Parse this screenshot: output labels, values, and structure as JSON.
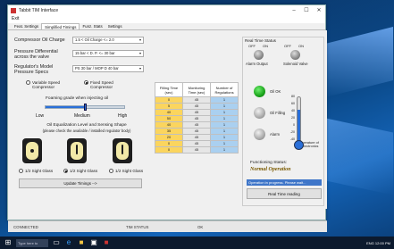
{
  "window": {
    "title": "Tabbit TIM Interface",
    "controls": [
      "–",
      "☐",
      "✕"
    ],
    "menu": "Exit"
  },
  "tabs": [
    {
      "label": "Feat. Settings",
      "active": false
    },
    {
      "label": "Simplified Timings",
      "active": true
    },
    {
      "label": "Funz. Stats",
      "active": false
    },
    {
      "label": "Settings",
      "active": false
    }
  ],
  "form": {
    "compressor_oil_label": "Compressor Oil Charge",
    "compressor_oil_value": "1.5 < Oil Charge <= 2.0",
    "pressure_label_1": "Pressure Differential",
    "pressure_label_2": "across the valve",
    "pressure_value": "15 bar < D. P. <= 30 bar",
    "regulator_label_1": "Regulator's Model",
    "regulator_label_2": "Pressure Specs",
    "regulator_value": "PS 30 bar / MOP D 40 bar",
    "variable_speed_1": "Variable Speed",
    "variable_speed_2": "Compressor",
    "fixed_speed_1": "Fixed Speed",
    "fixed_speed_2": "Compressor",
    "fixed_speed_selected": true,
    "foaming_label": "Foaming grade when injecting oil",
    "foaming_levels": [
      "Low",
      "Medium",
      "High"
    ],
    "foaming_level_fraction": 0.5,
    "equalization_label_1": "Oil Equalization Level and Sensing Shape",
    "equalization_label_2": "(please check the available / installed regulator body)",
    "sight_options": [
      "1/2 Sight Glass",
      "1/2 Sight Glass",
      "1/2 Sight Glass"
    ],
    "sight_selected_index": 1,
    "update_button": "Update Timings -->"
  },
  "table": {
    "headers": [
      "Filling Time (sec)",
      "Monitoring Time (sec)",
      "Number of Regulations"
    ],
    "rows": [
      [
        "0",
        "45",
        "1"
      ],
      [
        "5",
        "45",
        "1"
      ],
      [
        "40",
        "45",
        "1"
      ],
      [
        "50",
        "45",
        "1"
      ],
      [
        "40",
        "45",
        "1"
      ],
      [
        "35",
        "45",
        "1"
      ],
      [
        "20",
        "45",
        "1"
      ],
      [
        "0",
        "45",
        "1"
      ],
      [
        "0",
        "45",
        "1"
      ]
    ]
  },
  "realtime": {
    "title": "Real Time Status",
    "switch1_states": [
      "OFF",
      "ON"
    ],
    "switch2_states": [
      "OFF",
      "ON"
    ],
    "switch1_label": "Alarm Output",
    "switch2_label": "Solenoid Valve",
    "led1_label": "Oil OK",
    "led2_label": "Oil Filling",
    "led3_label": "Alarm",
    "thermo_ticks": [
      "80",
      "60",
      "40",
      "20",
      "0",
      "-20",
      "-40"
    ],
    "thermo_label_1": "Temperature of",
    "thermo_label_2": "the Electronics",
    "thermo_value_fraction": 0.72,
    "functioning_label": "Functioning Status:",
    "functioning_value": "Normal Operation",
    "progress_text": "Operation in progress. Please wait...",
    "realtime_button": "Real Time reading"
  },
  "status_bar": {
    "left": "CONNECTED",
    "middle": "TIM STATUS",
    "right": "OK"
  },
  "taskbar": {
    "search_placeholder": "Type here to search",
    "tray": "ENG 12:00 PM"
  },
  "colors": {
    "filling": "#fbd55e",
    "monitoring": "#e6e6e6",
    "regulations": "#aad0f0",
    "accent": "#2a6fd8",
    "ok_led": "#1aa31a",
    "status_text": "#7a5a00"
  }
}
